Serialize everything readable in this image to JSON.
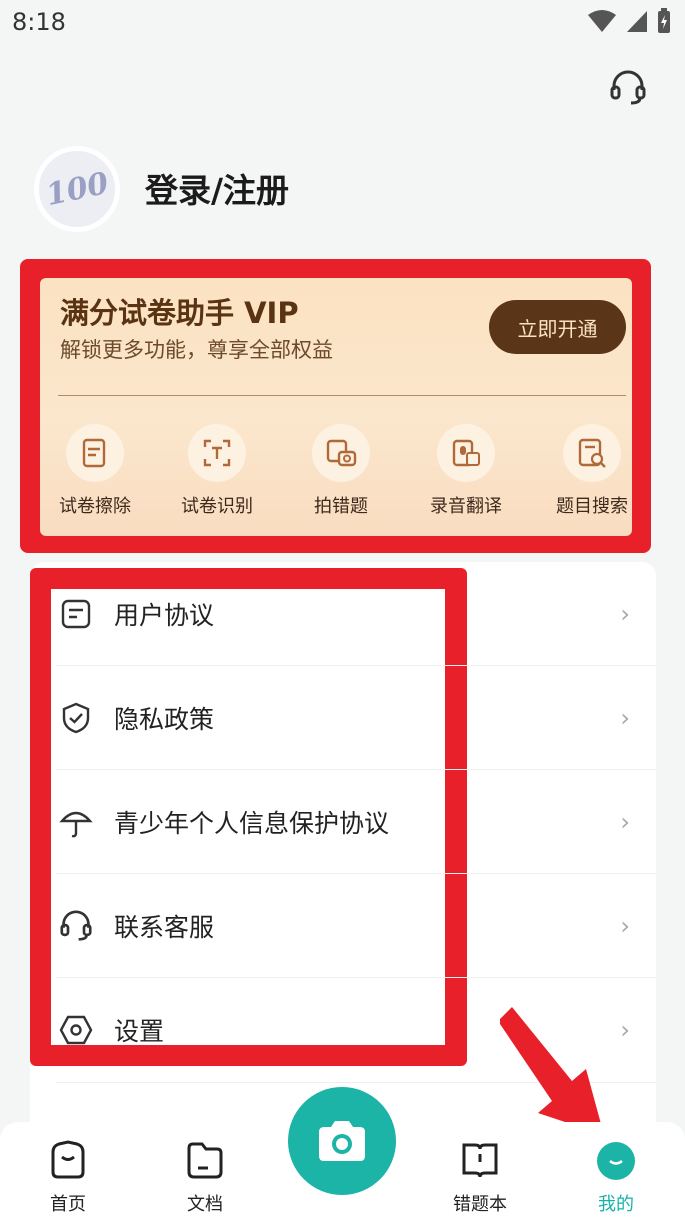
{
  "status": {
    "time": "8:18"
  },
  "profile": {
    "avatar_text": "100",
    "login_label": "登录/注册"
  },
  "vip": {
    "title": "满分试卷助手 VIP",
    "subtitle": "解锁更多功能，尊享全部权益",
    "button_label": "立即开通",
    "features": [
      {
        "label": "试卷擦除",
        "icon": "eraser-doc-icon"
      },
      {
        "label": "试卷识别",
        "icon": "text-scan-icon"
      },
      {
        "label": "拍错题",
        "icon": "camera-question-icon"
      },
      {
        "label": "录音翻译",
        "icon": "mic-translate-icon"
      },
      {
        "label": "题目搜索",
        "icon": "doc-search-icon"
      }
    ]
  },
  "menu": {
    "items": [
      {
        "label": "用户协议",
        "icon": "document-icon"
      },
      {
        "label": "隐私政策",
        "icon": "shield-check-icon"
      },
      {
        "label": "青少年个人信息保护协议",
        "icon": "umbrella-icon"
      },
      {
        "label": "联系客服",
        "icon": "headset-icon"
      },
      {
        "label": "设置",
        "icon": "hexagon-settings-icon"
      }
    ]
  },
  "tabs": [
    {
      "label": "首页",
      "icon": "home-icon"
    },
    {
      "label": "文档",
      "icon": "folder-icon"
    },
    {
      "label": "错题本",
      "icon": "book-icon"
    },
    {
      "label": "我的",
      "icon": "profile-icon"
    }
  ],
  "colors": {
    "accent": "#1cb4a7",
    "vip_brown": "#5b3517",
    "highlight": "#e8202a"
  }
}
